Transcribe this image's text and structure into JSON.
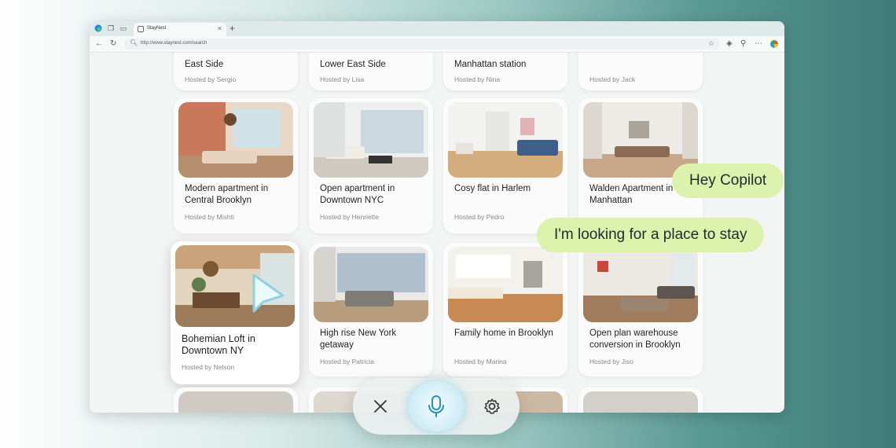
{
  "browser": {
    "tab_title": "StayNest",
    "url": "http://www.staynest.com/search",
    "icons": [
      "edge-icon",
      "workspaces-icon",
      "tab-actions-icon",
      "close-icon",
      "plus-icon",
      "back-icon",
      "refresh-icon",
      "lock-icon",
      "star-icon",
      "copilot-icon",
      "extensions-icon",
      "favorites-icon",
      "more-icon",
      "profile-icon"
    ]
  },
  "listings": {
    "top": [
      {
        "title": "East Side",
        "host": "Hosted by Sergio"
      },
      {
        "title": "Lower East Side",
        "host": "Hosted by Lisa"
      },
      {
        "title": "Manhattan station",
        "host": "Hosted by Nina"
      },
      {
        "title": "",
        "host": "Hosted by Jack"
      }
    ],
    "row1": [
      {
        "title": "Modern apartment in Central Brooklyn",
        "host": "Hosted by Mishti"
      },
      {
        "title": "Open apartment in Downtown NYC",
        "host": "Hosted by Henriette"
      },
      {
        "title": "Cosy flat in Harlem",
        "host": "Hosted by Pedro"
      },
      {
        "title": "Walden Apartment in Manhattan",
        "host": ""
      }
    ],
    "row2": [
      {
        "title": "Bohemian Loft in Downtown NY",
        "host": "Hosted by Nelson"
      },
      {
        "title": "High rise New York getaway",
        "host": "Hosted by Patricia"
      },
      {
        "title": "Family home in Brooklyn",
        "host": "Hosted by Marina"
      },
      {
        "title": "Open plan warehouse conversion in Brooklyn",
        "host": "Hosted by Jiso"
      }
    ]
  },
  "copilot": {
    "messages": [
      "Hey Copilot",
      "I'm looking for a place to stay"
    ]
  },
  "voice_controls": {
    "icons": [
      "close-icon",
      "microphone-icon",
      "settings-icon"
    ]
  }
}
